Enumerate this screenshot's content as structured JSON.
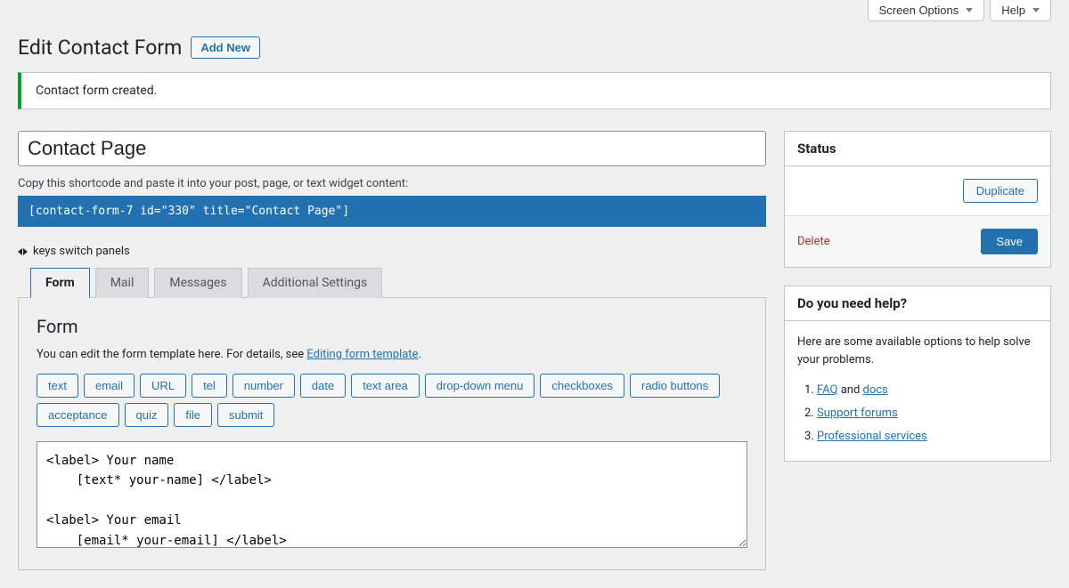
{
  "topbar": {
    "screen_options": "Screen Options",
    "help": "Help"
  },
  "header": {
    "title": "Edit Contact Form",
    "add_new": "Add New"
  },
  "notice": {
    "message": "Contact form created."
  },
  "form": {
    "title_value": "Contact Page",
    "shortcode_label": "Copy this shortcode and paste it into your post, page, or text widget content:",
    "shortcode_value": "[contact-form-7 id=\"330\" title=\"Contact Page\"]",
    "keys_hint": "keys switch panels"
  },
  "tabs": [
    {
      "label": "Form",
      "active": true
    },
    {
      "label": "Mail",
      "active": false
    },
    {
      "label": "Messages",
      "active": false
    },
    {
      "label": "Additional Settings",
      "active": false
    }
  ],
  "panel": {
    "title": "Form",
    "desc_pre": "You can edit the form template here. For details, see ",
    "desc_link": "Editing form template",
    "desc_post": ".",
    "tags": [
      "text",
      "email",
      "URL",
      "tel",
      "number",
      "date",
      "text area",
      "drop-down menu",
      "checkboxes",
      "radio buttons",
      "acceptance",
      "quiz",
      "file",
      "submit"
    ],
    "template": "<label> Your name\n    [text* your-name] </label>\n\n<label> Your email\n    [email* your-email] </label>"
  },
  "sidebar": {
    "status": {
      "title": "Status",
      "duplicate": "Duplicate",
      "delete": "Delete",
      "save": "Save"
    },
    "help": {
      "title": "Do you need help?",
      "text": "Here are some available options to help solve your problems.",
      "items": [
        {
          "pre": "",
          "link": "FAQ",
          "mid": " and ",
          "link2": "docs",
          "post": ""
        },
        {
          "pre": "",
          "link": "Support forums",
          "mid": "",
          "link2": "",
          "post": ""
        },
        {
          "pre": "",
          "link": "Professional services",
          "mid": "",
          "link2": "",
          "post": ""
        }
      ]
    }
  }
}
